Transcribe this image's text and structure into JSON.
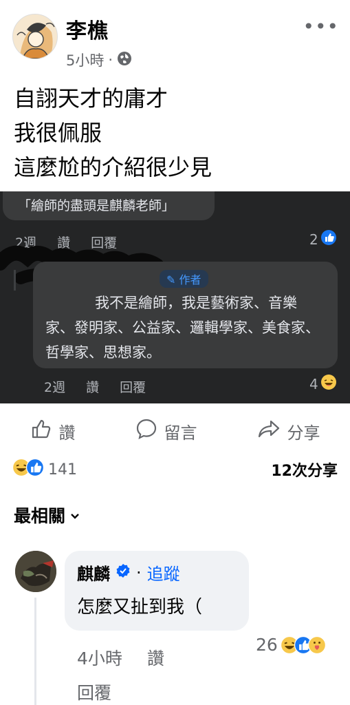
{
  "post": {
    "author": "李樵",
    "time": "5小時",
    "dot": "·",
    "more": "•••",
    "lines": [
      "自詡天才的庸才",
      "我很佩服",
      "這麼尬的介紹很少見"
    ]
  },
  "screenshot": {
    "quote": "「繪師的盡頭是麒麟老師」",
    "c1_time": "2週",
    "c1_like": "讚",
    "c1_reply": "回覆",
    "c1_count": "2",
    "author_badge": "作者",
    "reply_text": "我不是繪師，我是藝術家、音樂家、發明家、公益家、邏輯學家、美食家、哲學家、思想家。",
    "c2_time": "2週",
    "c2_like": "讚",
    "c2_reply": "回覆",
    "c2_count": "4"
  },
  "actions": {
    "like": "讚",
    "comment": "留言",
    "share": "分享"
  },
  "stats": {
    "reactions": "141",
    "shares": "12次分享"
  },
  "sort": {
    "label": "最相關"
  },
  "comment": {
    "name": "麒麟",
    "follow": "追蹤",
    "text": "怎麼又扯到我（",
    "time": "4小時",
    "like": "讚",
    "reply": "回覆",
    "reactions": "26"
  },
  "colors": {
    "accent": "#0866ff",
    "secondary_text": "#65676b",
    "dark_bg": "#242526",
    "dark_bubble": "#3a3b3c"
  }
}
